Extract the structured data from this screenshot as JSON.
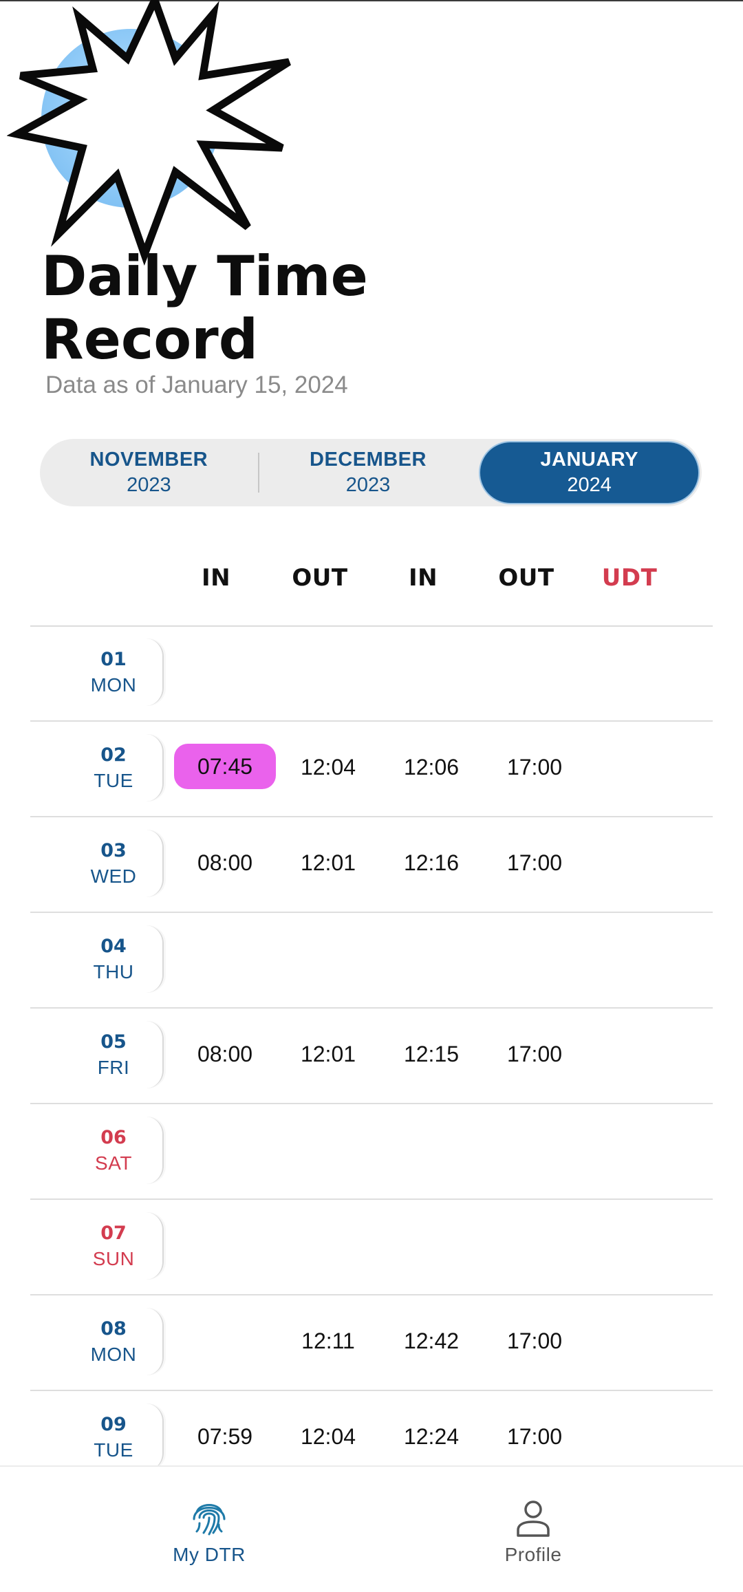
{
  "user": {
    "name": "",
    "sub": ""
  },
  "page": {
    "title_line1": "Daily Time",
    "title_line2": "Record",
    "subtitle": "Data as of January 15, 2024"
  },
  "months": [
    {
      "month": "NOVEMBER",
      "year": "2023",
      "active": false
    },
    {
      "month": "DECEMBER",
      "year": "2023",
      "active": false
    },
    {
      "month": "JANUARY",
      "year": "2024",
      "active": true
    }
  ],
  "columns": [
    "IN",
    "OUT",
    "IN",
    "OUT",
    "UDT"
  ],
  "rows": [
    {
      "day": "01",
      "dow": "MON",
      "weekend": false,
      "times": [
        "",
        "",
        "",
        ""
      ],
      "highlight": -1
    },
    {
      "day": "02",
      "dow": "TUE",
      "weekend": false,
      "times": [
        "07:45",
        "12:04",
        "12:06",
        "17:00"
      ],
      "highlight": 0
    },
    {
      "day": "03",
      "dow": "WED",
      "weekend": false,
      "times": [
        "08:00",
        "12:01",
        "12:16",
        "17:00"
      ],
      "highlight": -1
    },
    {
      "day": "04",
      "dow": "THU",
      "weekend": false,
      "times": [
        "",
        "",
        "",
        ""
      ],
      "highlight": -1
    },
    {
      "day": "05",
      "dow": "FRI",
      "weekend": false,
      "times": [
        "08:00",
        "12:01",
        "12:15",
        "17:00"
      ],
      "highlight": -1
    },
    {
      "day": "06",
      "dow": "SAT",
      "weekend": true,
      "times": [
        "",
        "",
        "",
        ""
      ],
      "highlight": -1
    },
    {
      "day": "07",
      "dow": "SUN",
      "weekend": true,
      "times": [
        "",
        "",
        "",
        ""
      ],
      "highlight": -1
    },
    {
      "day": "08",
      "dow": "MON",
      "weekend": false,
      "times": [
        "",
        "12:11",
        "12:42",
        "17:00"
      ],
      "highlight": -1
    },
    {
      "day": "09",
      "dow": "TUE",
      "weekend": false,
      "times": [
        "07:59",
        "12:04",
        "12:24",
        "17:00"
      ],
      "highlight": -1
    }
  ],
  "nav": {
    "dtr_label": "My DTR",
    "dtr_icon": "fingerprint-icon",
    "profile_label": "Profile",
    "profile_icon": "person-icon"
  },
  "colors": {
    "primary": "#165a93",
    "accent_red": "#d33c4f",
    "highlight": "#ea62ec"
  }
}
